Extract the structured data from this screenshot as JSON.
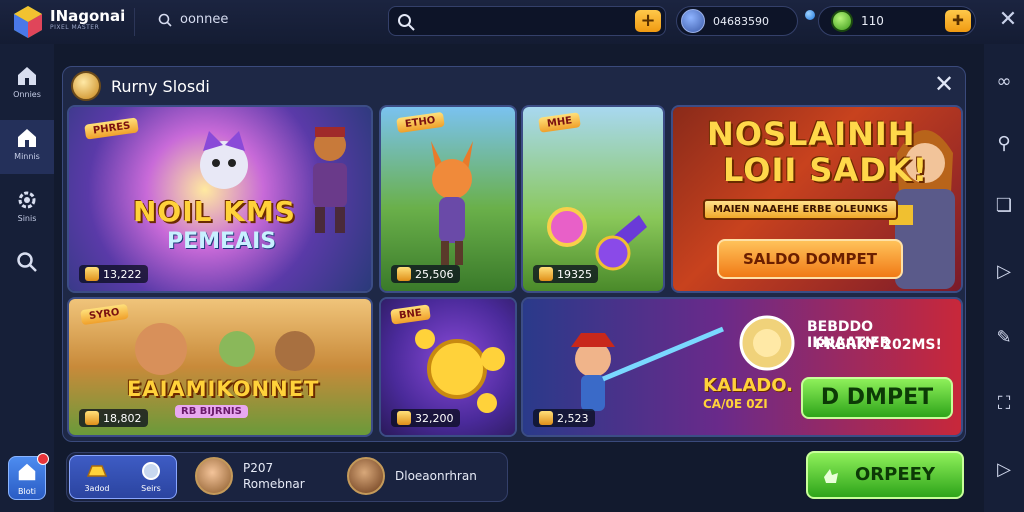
{
  "app": {
    "name": "INagonai",
    "subtitle": "PIXEL MASTER"
  },
  "topbar": {
    "search_label": "oonnee",
    "search": {
      "value": "",
      "placeholder": ""
    },
    "account_id": "04683590",
    "coins": "110"
  },
  "sidebar": {
    "items": [
      {
        "label": "Onnies",
        "icon": "home-icon"
      },
      {
        "label": "Minnis",
        "icon": "home-icon"
      },
      {
        "label": "Sinis",
        "icon": "settings-icon"
      },
      {
        "label": "",
        "icon": "search-icon"
      }
    ],
    "home_label": "Bloti"
  },
  "panel": {
    "title": "Rurny Slosdi",
    "cards": [
      {
        "tag": "PHRES",
        "title": "NOIL KMS",
        "subtitle": "PEMEAIS",
        "count": "13,222"
      },
      {
        "tag": "ETHO",
        "count": "25,506"
      },
      {
        "tag": "MHE",
        "count": "19325"
      },
      {
        "title": "NOSLAINIH",
        "title2": "LOII SADK!",
        "banner": "MAIEN NAAEHE ERBE OLEUNKS",
        "button": "SALDO DOMPET"
      },
      {
        "tag": "SYRO",
        "title": "EAIAMIKONNET",
        "subtitle": "RB BIJRNIS",
        "count": "18,802"
      },
      {
        "tag": "BNE",
        "count": "32,200"
      },
      {
        "count": "2,523",
        "headline": "BEBDDO IKNAATIER",
        "headline2": "PRERKY 202MS!",
        "side_text": "KALADO.",
        "side_text2": "CA/0E 0ZI",
        "button": "D DMPET"
      }
    ]
  },
  "bottom": {
    "items": [
      {
        "label": "3adod"
      },
      {
        "label": "Seirs"
      }
    ],
    "players": [
      {
        "name": "P207",
        "sub": "Romebnar"
      },
      {
        "name": "Dloeaonrhran",
        "sub": ""
      }
    ]
  },
  "action_button": "ORPEEY",
  "colors": {
    "accent_orange": "#f09a12",
    "accent_green": "#2ea41a",
    "panel_bg": "#1e2846",
    "app_bg": "#121a2e"
  }
}
